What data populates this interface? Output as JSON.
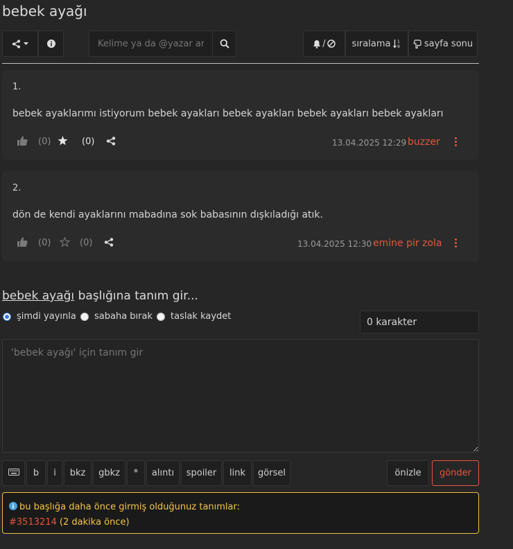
{
  "topic": {
    "title": "bebek ayağı"
  },
  "toolbar": {
    "search_placeholder": "Kelime ya da @yazar ara",
    "notify_label": "/",
    "sort_label": "sıralama",
    "page_end_label": "sayfa sonu"
  },
  "entries": [
    {
      "number": "1.",
      "text": "bebek ayaklarımı istiyorum bebek ayakları bebek ayakları bebek ayakları bebek ayakları",
      "upvotes": "(0)",
      "favorites": "(0)",
      "favorited": true,
      "date": "13.04.2025 12:29",
      "author": "buzzer"
    },
    {
      "number": "2.",
      "text": "dön de kendi ayaklarını mabadına sok babasının dışkıladığı atık.",
      "upvotes": "(0)",
      "favorites": "(0)",
      "favorited": false,
      "date": "13.04.2025 12:30",
      "author": "emine pir zola"
    }
  ],
  "compose": {
    "heading_link": "bebek ayağı",
    "heading_rest": " başlığına tanım gir...",
    "radio_publish": "şimdi yayınla",
    "radio_tomorrow": "sabaha bırak",
    "radio_draft": "taslak kaydet",
    "char_count": "0 karakter",
    "textarea_placeholder": "'bebek ayağı' için tanım gir",
    "buttons": {
      "b": "b",
      "i": "i",
      "bkz": "bkz",
      "gbkz": "gbkz",
      "star": "*",
      "quote": "alıntı",
      "spoiler": "spoiler",
      "link": "link",
      "image": "görsel",
      "preview": "önizle",
      "send": "gönder"
    }
  },
  "notice": {
    "text": "bu başlığa daha önce girmiş olduğunuz tanımlar:",
    "entry_id": "#3513214",
    "when": " (2 dakika önce)"
  },
  "colors": {
    "accent": "#e8553a",
    "notice_border": "#f0c040",
    "notice_text": "#f5c542"
  }
}
